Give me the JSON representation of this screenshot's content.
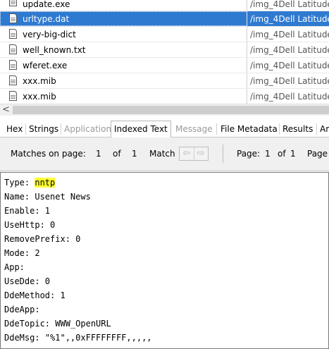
{
  "files": [
    {
      "name": "update.exe",
      "path": "/img_4Dell Latitude",
      "selected": false
    },
    {
      "name": "urltype.dat",
      "path": "/img_4Dell Latitude",
      "selected": true
    },
    {
      "name": "very-big-dict",
      "path": "/img_4Dell Latitude",
      "selected": false
    },
    {
      "name": "well_known.txt",
      "path": "/img_4Dell Latitude",
      "selected": false
    },
    {
      "name": "wferet.exe",
      "path": "/img_4Dell Latitude",
      "selected": false
    },
    {
      "name": "xxx.mib",
      "path": "/img_4Dell Latitude",
      "selected": false
    },
    {
      "name": "xxx.mib",
      "path": "/img_4Dell Latitude",
      "selected": false
    }
  ],
  "scrollbar": {
    "left_arrow": "<"
  },
  "tabs": [
    {
      "label": "Hex",
      "state": "normal"
    },
    {
      "label": "Strings",
      "state": "normal"
    },
    {
      "label": "Application",
      "state": "disabled"
    },
    {
      "label": "Indexed Text",
      "state": "active"
    },
    {
      "label": "Message",
      "state": "disabled"
    },
    {
      "label": "File Metadata",
      "state": "normal"
    },
    {
      "label": "Results",
      "state": "normal"
    },
    {
      "label": "An",
      "state": "normal"
    }
  ],
  "toolbar": {
    "matches_label": "Matches on page:",
    "match_current": "1",
    "of_label": "of",
    "match_total": "1",
    "match_label": "Match",
    "prev_icon": "⇦",
    "next_icon": "⇨",
    "page_label": "Page:",
    "page_current": "1",
    "page_of_label": "of",
    "page_total": "1",
    "page_label_2": "Page"
  },
  "content": {
    "lines": [
      {
        "prefix": "Type: ",
        "highlight": "nntp"
      },
      {
        "prefix": "Name: Usenet News",
        "highlight": ""
      },
      {
        "prefix": "Enable: 1",
        "highlight": ""
      },
      {
        "prefix": "UseHttp: 0",
        "highlight": ""
      },
      {
        "prefix": "RemovePrefix: 0",
        "highlight": ""
      },
      {
        "prefix": "Mode: 2",
        "highlight": ""
      },
      {
        "prefix": "App:",
        "highlight": ""
      },
      {
        "prefix": "UseDde: 0",
        "highlight": ""
      },
      {
        "prefix": "DdeMethod: 1",
        "highlight": ""
      },
      {
        "prefix": "DdeApp:",
        "highlight": ""
      },
      {
        "prefix": "DdeTopic: WWW_OpenURL",
        "highlight": ""
      },
      {
        "prefix": "DdeMsg: \"%1\",,0xFFFFFFFF,,,,,",
        "highlight": ""
      }
    ],
    "highlight_color": "#ffff33"
  },
  "colors": {
    "selection": "#2f7ad1"
  }
}
